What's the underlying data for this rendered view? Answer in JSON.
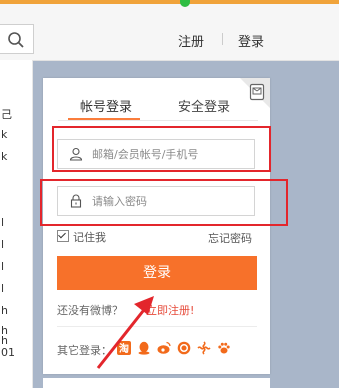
{
  "header": {
    "register_label": "注册",
    "login_label": "登录"
  },
  "left_panel": {
    "items": [
      "己",
      "k",
      "k",
      "l",
      "l",
      "l",
      "l",
      "h",
      "h",
      "h",
      "01"
    ]
  },
  "login": {
    "tabs": [
      {
        "label": "帐号登录",
        "active": true
      },
      {
        "label": "安全登录",
        "active": false
      }
    ],
    "username_placeholder": "邮箱/会员帐号/手机号",
    "password_placeholder": "请输入密码",
    "remember_label": "记住我",
    "forgot_label": "忘记密码",
    "submit_label": "登录",
    "no_account_text": "还没有微博？",
    "register_link_label": "立即注册!",
    "other_login_label": "其它登录：",
    "social_icons": [
      "taobao-icon",
      "qq-icon",
      "weibo-icon",
      "360-icon",
      "unicom-icon",
      "paw-icon"
    ]
  },
  "colors": {
    "accent": "#f7712a",
    "annotation_red": "#e3262c"
  }
}
